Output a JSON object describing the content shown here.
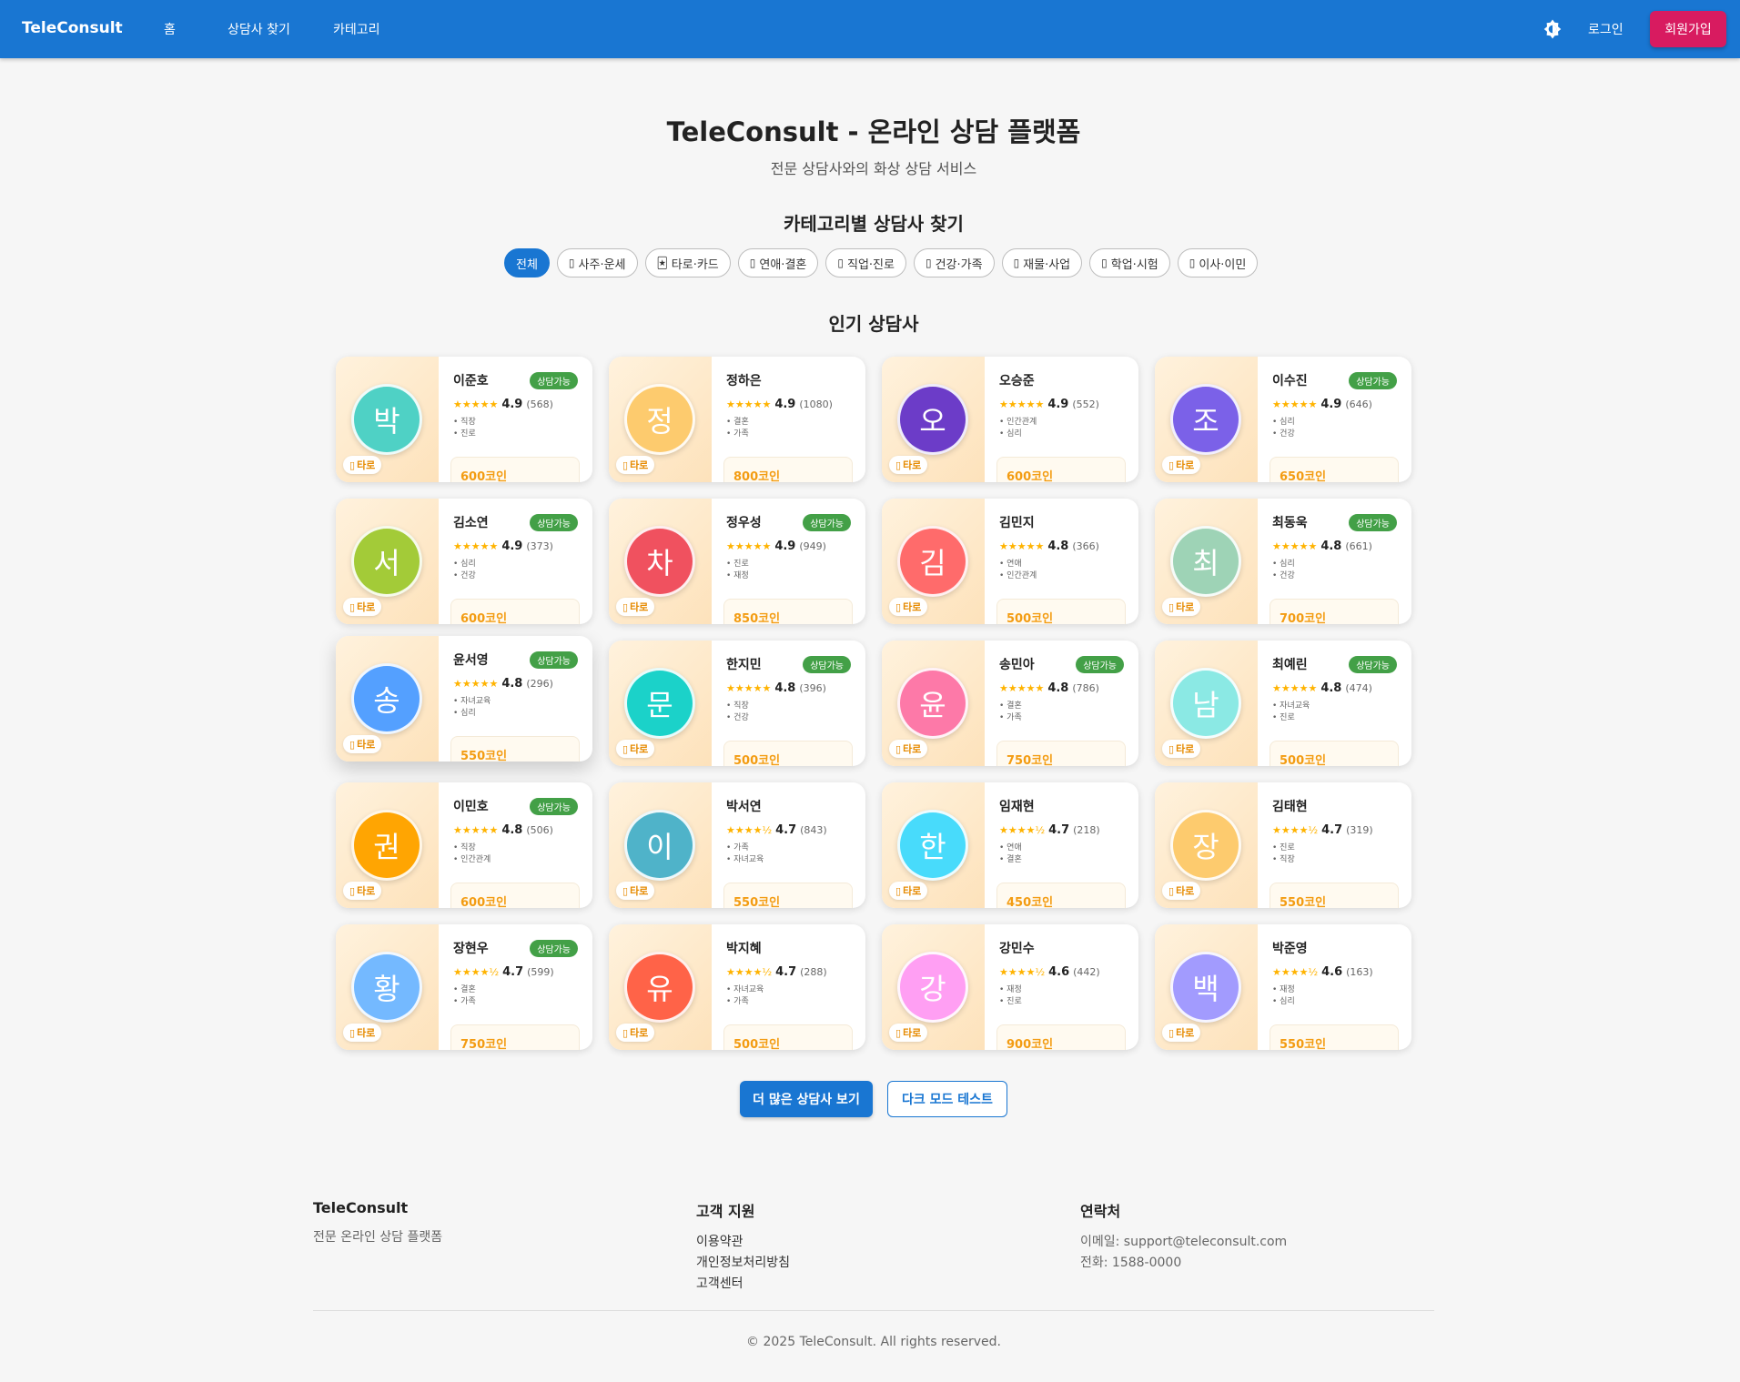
{
  "nav": {
    "brand": "TeleConsult",
    "links": [
      "홈",
      "상담사 찾기",
      "카테고리"
    ],
    "login": "로그인",
    "signup": "회원가입"
  },
  "hero": {
    "title": "TeleConsult - 온라인 상담 플랫폼",
    "subtitle": "전문 상담사와의 화상 상담 서비스"
  },
  "categories": {
    "title": "카테고리별 상담사 찾기",
    "chips": [
      {
        "label": "전체",
        "icon": "",
        "active": true
      },
      {
        "label": "사주·운세",
        "icon": "▯"
      },
      {
        "label": "타로·카드",
        "icon": "🃏"
      },
      {
        "label": "연애·결혼",
        "icon": "▯"
      },
      {
        "label": "직업·진로",
        "icon": "▯"
      },
      {
        "label": "건강·가족",
        "icon": "▯"
      },
      {
        "label": "재물·사업",
        "icon": "▯"
      },
      {
        "label": "학업·시험",
        "icon": "▯"
      },
      {
        "label": "이사·이민",
        "icon": "▯"
      }
    ]
  },
  "popular": {
    "title": "인기 상담사",
    "tag_label": "타로",
    "tag_icon": "▯",
    "available_label": "상담가능",
    "counselors": [
      {
        "initial": "박",
        "color": "#4fd1c5",
        "name": "이준호",
        "available": true,
        "stars": "★★★★★",
        "rating": "4.9",
        "reviews": "(568)",
        "specs": [
          "직장",
          "진로"
        ],
        "price": "600코인"
      },
      {
        "initial": "정",
        "color": "#fdcb6e",
        "name": "정하은",
        "available": false,
        "stars": "★★★★★",
        "rating": "4.9",
        "reviews": "(1080)",
        "specs": [
          "결혼",
          "가족"
        ],
        "price": "800코인"
      },
      {
        "initial": "오",
        "color": "#6c3cc8",
        "name": "오승준",
        "available": false,
        "stars": "★★★★★",
        "rating": "4.9",
        "reviews": "(552)",
        "specs": [
          "인간관계",
          "심리"
        ],
        "price": "600코인"
      },
      {
        "initial": "조",
        "color": "#7b61e8",
        "name": "이수진",
        "available": true,
        "stars": "★★★★★",
        "rating": "4.9",
        "reviews": "(646)",
        "specs": [
          "심리",
          "건강"
        ],
        "price": "650코인"
      },
      {
        "initial": "서",
        "color": "#a3cb38",
        "name": "김소연",
        "available": true,
        "stars": "★★★★★",
        "rating": "4.9",
        "reviews": "(373)",
        "specs": [
          "심리",
          "건강"
        ],
        "price": "600코인"
      },
      {
        "initial": "차",
        "color": "#f0515f",
        "name": "정우성",
        "available": true,
        "stars": "★★★★★",
        "rating": "4.9",
        "reviews": "(949)",
        "specs": [
          "진로",
          "재정"
        ],
        "price": "850코인"
      },
      {
        "initial": "김",
        "color": "#ff6b6b",
        "name": "김민지",
        "available": false,
        "stars": "★★★★★",
        "rating": "4.8",
        "reviews": "(366)",
        "specs": [
          "연애",
          "인간관계"
        ],
        "price": "500코인"
      },
      {
        "initial": "최",
        "color": "#9ed3b6",
        "name": "최동욱",
        "available": true,
        "stars": "★★★★★",
        "rating": "4.8",
        "reviews": "(661)",
        "specs": [
          "심리",
          "건강"
        ],
        "price": "700코인"
      },
      {
        "initial": "송",
        "color": "#54a0ff",
        "name": "윤서영",
        "available": true,
        "stars": "★★★★★",
        "rating": "4.8",
        "reviews": "(296)",
        "specs": [
          "자녀교육",
          "심리"
        ],
        "price": "550코인",
        "hovered": true
      },
      {
        "initial": "문",
        "color": "#1bd2c9",
        "name": "한지민",
        "available": true,
        "stars": "★★★★★",
        "rating": "4.8",
        "reviews": "(396)",
        "specs": [
          "직장",
          "건강"
        ],
        "price": "500코인"
      },
      {
        "initial": "윤",
        "color": "#fd79a8",
        "name": "송민아",
        "available": true,
        "stars": "★★★★★",
        "rating": "4.8",
        "reviews": "(786)",
        "specs": [
          "결혼",
          "가족"
        ],
        "price": "750코인"
      },
      {
        "initial": "남",
        "color": "#8be9e4",
        "name": "최예린",
        "available": true,
        "stars": "★★★★★",
        "rating": "4.8",
        "reviews": "(474)",
        "specs": [
          "자녀교육",
          "진로"
        ],
        "price": "500코인"
      },
      {
        "initial": "권",
        "color": "#ffa502",
        "name": "이민호",
        "available": true,
        "stars": "★★★★★",
        "rating": "4.8",
        "reviews": "(506)",
        "specs": [
          "직장",
          "인간관계"
        ],
        "price": "600코인"
      },
      {
        "initial": "이",
        "color": "#4fb3c9",
        "name": "박서연",
        "available": false,
        "stars": "★★★★½",
        "rating": "4.7",
        "reviews": "(843)",
        "specs": [
          "가족",
          "자녀교육"
        ],
        "price": "550코인"
      },
      {
        "initial": "한",
        "color": "#48dbfb",
        "name": "임재현",
        "available": false,
        "stars": "★★★★½",
        "rating": "4.7",
        "reviews": "(218)",
        "specs": [
          "연애",
          "결혼"
        ],
        "price": "450코인"
      },
      {
        "initial": "장",
        "color": "#fdcb6e",
        "name": "김태현",
        "available": false,
        "stars": "★★★★½",
        "rating": "4.7",
        "reviews": "(319)",
        "specs": [
          "진로",
          "직장"
        ],
        "price": "550코인"
      },
      {
        "initial": "황",
        "color": "#74b9ff",
        "name": "장현우",
        "available": true,
        "stars": "★★★★½",
        "rating": "4.7",
        "reviews": "(599)",
        "specs": [
          "결혼",
          "가족"
        ],
        "price": "750코인"
      },
      {
        "initial": "유",
        "color": "#ff6348",
        "name": "박지혜",
        "available": false,
        "stars": "★★★★½",
        "rating": "4.7",
        "reviews": "(288)",
        "specs": [
          "자녀교육",
          "가족"
        ],
        "price": "500코인"
      },
      {
        "initial": "강",
        "color": "#ff9ff3",
        "name": "강민수",
        "available": false,
        "stars": "★★★★½",
        "rating": "4.6",
        "reviews": "(442)",
        "specs": [
          "재정",
          "진로"
        ],
        "price": "900코인"
      },
      {
        "initial": "백",
        "color": "#a29bfe",
        "name": "박준영",
        "available": false,
        "stars": "★★★★½",
        "rating": "4.6",
        "reviews": "(163)",
        "specs": [
          "재정",
          "심리"
        ],
        "price": "550코인"
      }
    ]
  },
  "actions": {
    "more": "더 많은 상담사 보기",
    "dark_mode": "다크 모드 테스트"
  },
  "footer": {
    "brand": "TeleConsult",
    "brand_desc": "전문 온라인 상담 플랫폼",
    "support_title": "고객 지원",
    "support_links": [
      "이용약관",
      "개인정보처리방침",
      "고객센터"
    ],
    "contact_title": "연락처",
    "email": "이메일: support@teleconsult.com",
    "phone": "전화: 1588-0000",
    "copyright": "© 2025 TeleConsult. All rights reserved."
  },
  "colors": {
    "primary": "#1976d2",
    "signup": "#d81b60",
    "available": "#43a047",
    "price": "#f39c12",
    "star": "#ffb300"
  }
}
